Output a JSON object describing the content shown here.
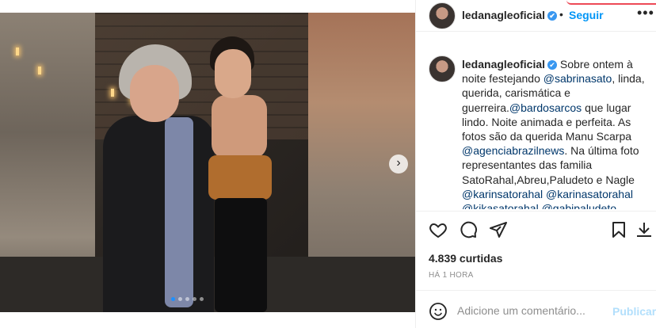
{
  "post": {
    "username": "ledanagleoficial",
    "follow_label": "Seguir",
    "separator": "•",
    "more_glyph": "•••",
    "verified_glyph": "✔",
    "caption": {
      "username": "ledanagleoficial",
      "text_1": " Sobre ontem à noite festejando ",
      "mention_1": "@sabrinasato",
      "text_2": ", linda, querida, carismática e guerreira.",
      "mention_2": "@bardosarcos",
      "text_3": " que lugar lindo. Noite animada e perfeita. As fotos são da querida Manu Scarpa ",
      "mention_3": "@agenciabrazilnews",
      "text_4": ". Na última foto representantes das familia SatoRahal,Abreu,Paludeto e Nagle ",
      "mention_4": "@karinsatorahal",
      "mention_5": "@karinasatorahal",
      "mention_6": "@kikasatorahal",
      "mention_7": "@gabipaludeto"
    },
    "likes": "4.839 curtidas",
    "time": "HÁ 1 HORA",
    "comment_placeholder": "Adicione um comentário...",
    "post_label": "Publicar"
  },
  "icons": {
    "like": "heart-icon",
    "comment": "comment-icon",
    "share": "share-icon",
    "save": "bookmark-icon",
    "emoji": "emoji-icon",
    "next": "chevron-right-icon"
  },
  "carousel": {
    "total": 5,
    "active": 0
  },
  "colors": {
    "accent": "#0095f6",
    "verified": "#3897f0",
    "mention": "#00376b",
    "post_disabled": "#b2dffc"
  }
}
